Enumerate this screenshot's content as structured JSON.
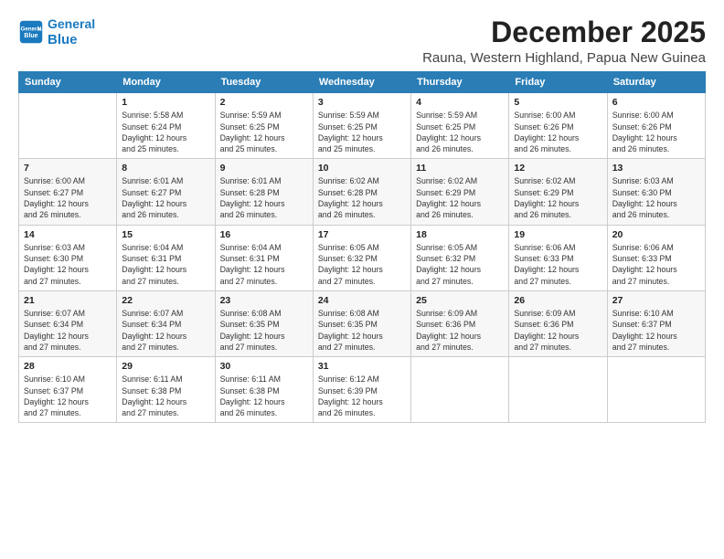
{
  "logo": {
    "line1": "General",
    "line2": "Blue"
  },
  "title": "December 2025",
  "location": "Rauna, Western Highland, Papua New Guinea",
  "days_header": [
    "Sunday",
    "Monday",
    "Tuesday",
    "Wednesday",
    "Thursday",
    "Friday",
    "Saturday"
  ],
  "weeks": [
    [
      {
        "day": "",
        "info": ""
      },
      {
        "day": "1",
        "info": "Sunrise: 5:58 AM\nSunset: 6:24 PM\nDaylight: 12 hours\nand 25 minutes."
      },
      {
        "day": "2",
        "info": "Sunrise: 5:59 AM\nSunset: 6:25 PM\nDaylight: 12 hours\nand 25 minutes."
      },
      {
        "day": "3",
        "info": "Sunrise: 5:59 AM\nSunset: 6:25 PM\nDaylight: 12 hours\nand 25 minutes."
      },
      {
        "day": "4",
        "info": "Sunrise: 5:59 AM\nSunset: 6:25 PM\nDaylight: 12 hours\nand 26 minutes."
      },
      {
        "day": "5",
        "info": "Sunrise: 6:00 AM\nSunset: 6:26 PM\nDaylight: 12 hours\nand 26 minutes."
      },
      {
        "day": "6",
        "info": "Sunrise: 6:00 AM\nSunset: 6:26 PM\nDaylight: 12 hours\nand 26 minutes."
      }
    ],
    [
      {
        "day": "7",
        "info": "Sunrise: 6:00 AM\nSunset: 6:27 PM\nDaylight: 12 hours\nand 26 minutes."
      },
      {
        "day": "8",
        "info": "Sunrise: 6:01 AM\nSunset: 6:27 PM\nDaylight: 12 hours\nand 26 minutes."
      },
      {
        "day": "9",
        "info": "Sunrise: 6:01 AM\nSunset: 6:28 PM\nDaylight: 12 hours\nand 26 minutes."
      },
      {
        "day": "10",
        "info": "Sunrise: 6:02 AM\nSunset: 6:28 PM\nDaylight: 12 hours\nand 26 minutes."
      },
      {
        "day": "11",
        "info": "Sunrise: 6:02 AM\nSunset: 6:29 PM\nDaylight: 12 hours\nand 26 minutes."
      },
      {
        "day": "12",
        "info": "Sunrise: 6:02 AM\nSunset: 6:29 PM\nDaylight: 12 hours\nand 26 minutes."
      },
      {
        "day": "13",
        "info": "Sunrise: 6:03 AM\nSunset: 6:30 PM\nDaylight: 12 hours\nand 26 minutes."
      }
    ],
    [
      {
        "day": "14",
        "info": "Sunrise: 6:03 AM\nSunset: 6:30 PM\nDaylight: 12 hours\nand 27 minutes."
      },
      {
        "day": "15",
        "info": "Sunrise: 6:04 AM\nSunset: 6:31 PM\nDaylight: 12 hours\nand 27 minutes."
      },
      {
        "day": "16",
        "info": "Sunrise: 6:04 AM\nSunset: 6:31 PM\nDaylight: 12 hours\nand 27 minutes."
      },
      {
        "day": "17",
        "info": "Sunrise: 6:05 AM\nSunset: 6:32 PM\nDaylight: 12 hours\nand 27 minutes."
      },
      {
        "day": "18",
        "info": "Sunrise: 6:05 AM\nSunset: 6:32 PM\nDaylight: 12 hours\nand 27 minutes."
      },
      {
        "day": "19",
        "info": "Sunrise: 6:06 AM\nSunset: 6:33 PM\nDaylight: 12 hours\nand 27 minutes."
      },
      {
        "day": "20",
        "info": "Sunrise: 6:06 AM\nSunset: 6:33 PM\nDaylight: 12 hours\nand 27 minutes."
      }
    ],
    [
      {
        "day": "21",
        "info": "Sunrise: 6:07 AM\nSunset: 6:34 PM\nDaylight: 12 hours\nand 27 minutes."
      },
      {
        "day": "22",
        "info": "Sunrise: 6:07 AM\nSunset: 6:34 PM\nDaylight: 12 hours\nand 27 minutes."
      },
      {
        "day": "23",
        "info": "Sunrise: 6:08 AM\nSunset: 6:35 PM\nDaylight: 12 hours\nand 27 minutes."
      },
      {
        "day": "24",
        "info": "Sunrise: 6:08 AM\nSunset: 6:35 PM\nDaylight: 12 hours\nand 27 minutes."
      },
      {
        "day": "25",
        "info": "Sunrise: 6:09 AM\nSunset: 6:36 PM\nDaylight: 12 hours\nand 27 minutes."
      },
      {
        "day": "26",
        "info": "Sunrise: 6:09 AM\nSunset: 6:36 PM\nDaylight: 12 hours\nand 27 minutes."
      },
      {
        "day": "27",
        "info": "Sunrise: 6:10 AM\nSunset: 6:37 PM\nDaylight: 12 hours\nand 27 minutes."
      }
    ],
    [
      {
        "day": "28",
        "info": "Sunrise: 6:10 AM\nSunset: 6:37 PM\nDaylight: 12 hours\nand 27 minutes."
      },
      {
        "day": "29",
        "info": "Sunrise: 6:11 AM\nSunset: 6:38 PM\nDaylight: 12 hours\nand 27 minutes."
      },
      {
        "day": "30",
        "info": "Sunrise: 6:11 AM\nSunset: 6:38 PM\nDaylight: 12 hours\nand 26 minutes."
      },
      {
        "day": "31",
        "info": "Sunrise: 6:12 AM\nSunset: 6:39 PM\nDaylight: 12 hours\nand 26 minutes."
      },
      {
        "day": "",
        "info": ""
      },
      {
        "day": "",
        "info": ""
      },
      {
        "day": "",
        "info": ""
      }
    ]
  ]
}
